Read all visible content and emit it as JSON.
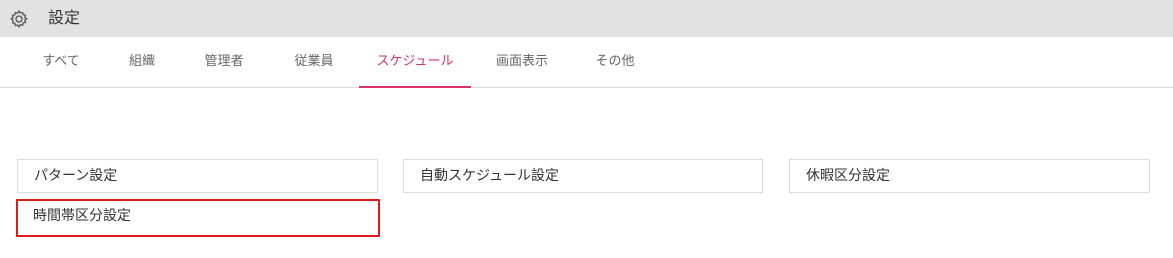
{
  "header": {
    "icon": "gear-icon",
    "title": "設定"
  },
  "tabs": [
    {
      "label": "すべて",
      "active": false
    },
    {
      "label": "組織",
      "active": false
    },
    {
      "label": "管理者",
      "active": false
    },
    {
      "label": "従業員",
      "active": false
    },
    {
      "label": "スケジュール",
      "active": true
    },
    {
      "label": "画面表示",
      "active": false
    },
    {
      "label": "その他",
      "active": false
    }
  ],
  "settings": {
    "pattern": "パターン設定",
    "auto_schedule": "自動スケジュール設定",
    "leave_category": "休暇区分設定",
    "time_slot_category": "時間帯区分設定"
  },
  "colors": {
    "accent": "#d6336c",
    "highlight_border": "#e01a1a",
    "header_bg": "#e2e2e2"
  }
}
